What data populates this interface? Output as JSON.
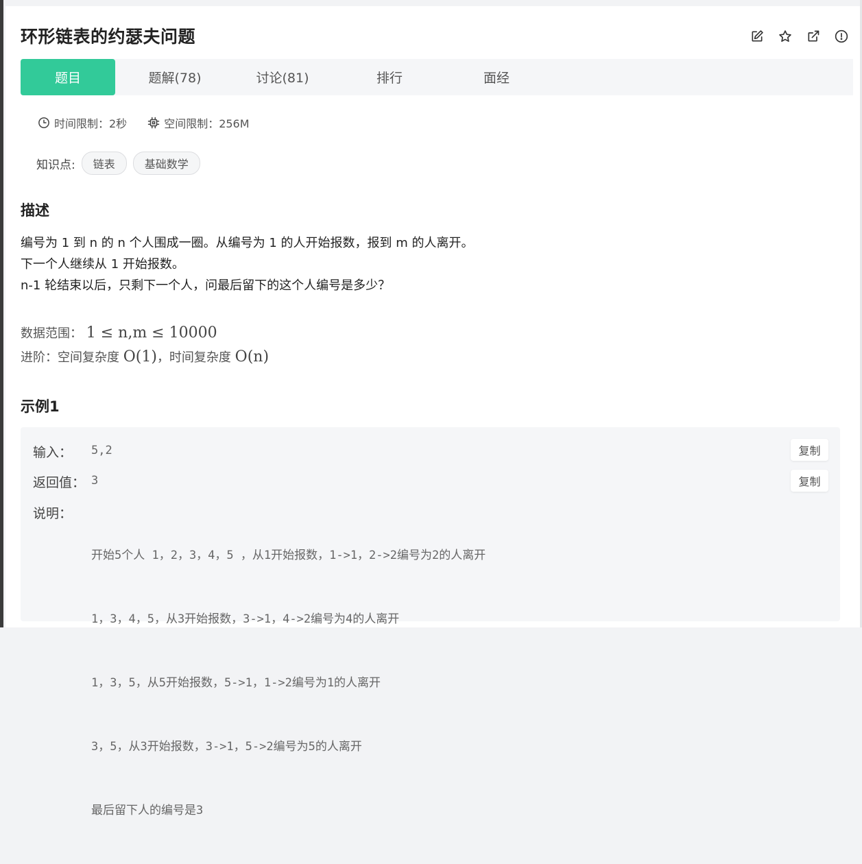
{
  "problem": {
    "title": "环形链表的约瑟夫问题"
  },
  "header_icons": [
    "edit-icon",
    "star-icon",
    "external-link-icon",
    "info-icon"
  ],
  "tabs": [
    {
      "label": "题目",
      "active": true
    },
    {
      "label": "题解(78)"
    },
    {
      "label": "讨论(81)"
    },
    {
      "label": "排行"
    },
    {
      "label": "面经"
    }
  ],
  "meta": {
    "time_limit": "时间限制：2秒",
    "space_limit": "空间限制：256M"
  },
  "knowledge": {
    "label": "知识点:",
    "tags": [
      "链表",
      "基础数学"
    ]
  },
  "description": {
    "heading": "描述",
    "lines": [
      "编号为 1 到 n 的 n 个人围成一圈。从编号为 1 的人开始报数，报到 m 的人离开。",
      "下一个人继续从 1 开始报数。",
      "n-1 轮结束以后，只剩下一个人，问最后留下的这个人编号是多少？"
    ],
    "range_label": "数据范围：",
    "range_math": "1 ≤ n,m ≤ 10000",
    "advanced_label": "进阶：空间复杂度",
    "space_complexity": "O(1)",
    "advanced_mid": "，时间复杂度",
    "time_complexity": "O(n)"
  },
  "example": {
    "heading": "示例1",
    "input_label": "输入：",
    "input_value": "5,2",
    "return_label": "返回值：",
    "return_value": "3",
    "explain_label": "说明：",
    "explain_lines": [
      "开始5个人 1，2，3，4，5 ，从1开始报数，1->1，2->2编号为2的人离开",
      "1，3，4，5，从3开始报数，3->1，4->2编号为4的人离开",
      "1，3，5，从5开始报数，5->1，1->2编号为1的人离开",
      "3，5，从3开始报数，3->1，5->2编号为5的人离开",
      "最后留下人的编号是3"
    ],
    "copy_label": "复制"
  }
}
